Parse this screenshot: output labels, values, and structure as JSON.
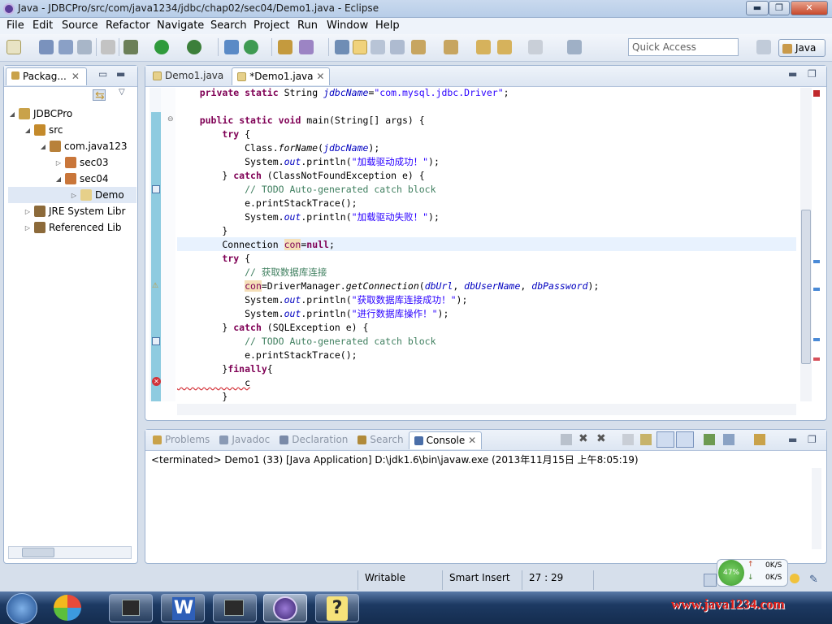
{
  "window": {
    "title": "Java - JDBCPro/src/com/java1234/jdbc/chap02/sec04/Demo1.java - Eclipse",
    "min": "▬",
    "max": "❐",
    "close": "✕"
  },
  "menu": [
    "File",
    "Edit",
    "Source",
    "Refactor",
    "Navigate",
    "Search",
    "Project",
    "Run",
    "Window",
    "Help"
  ],
  "toolbar": {
    "quick_access_placeholder": "Quick Access",
    "perspective": "Java"
  },
  "package_explorer": {
    "tab": "Packag...",
    "tree": [
      {
        "label": "JDBCPro",
        "twisty": "◢",
        "icon_color": "#c9a24a",
        "indent": 0
      },
      {
        "label": "src",
        "twisty": "◢",
        "icon_color": "#c48a2b",
        "indent": 1
      },
      {
        "label": "com.java123",
        "twisty": "◢",
        "icon_color": "#b8813a",
        "indent": 2
      },
      {
        "label": "sec03",
        "twisty": "▷",
        "icon_color": "#c9763a",
        "indent": 3
      },
      {
        "label": "sec04",
        "twisty": "◢",
        "icon_color": "#c9763a",
        "indent": 3
      },
      {
        "label": "Demo",
        "twisty": "▷",
        "icon_color": "#e6d08a",
        "indent": 4,
        "selected": true
      },
      {
        "label": "JRE System Libr",
        "twisty": "▷",
        "icon_color": "#8c6a3a",
        "indent": 1
      },
      {
        "label": "Referenced Lib",
        "twisty": "▷",
        "icon_color": "#8c6a3a",
        "indent": 1
      }
    ]
  },
  "editor": {
    "tabs": [
      {
        "label": "Demo1.java",
        "active": false
      },
      {
        "label": "*Demo1.java",
        "active": true
      }
    ],
    "lines": [
      [
        {
          "t": "    "
        },
        {
          "t": "private",
          "c": "kw"
        },
        {
          "t": " "
        },
        {
          "t": "static",
          "c": "kw"
        },
        {
          "t": " String "
        },
        {
          "t": "jdbcName",
          "c": "fi it"
        },
        {
          "t": "="
        },
        {
          "t": "\"com.mysql.jdbc.Driver\"",
          "c": "st"
        },
        {
          "t": ";"
        }
      ],
      [
        {
          "t": " "
        }
      ],
      [
        {
          "t": "    "
        },
        {
          "t": "public",
          "c": "kw"
        },
        {
          "t": " "
        },
        {
          "t": "static",
          "c": "kw"
        },
        {
          "t": " "
        },
        {
          "t": "void",
          "c": "kw"
        },
        {
          "t": " main(String[] args) {"
        }
      ],
      [
        {
          "t": "        "
        },
        {
          "t": "try",
          "c": "kw"
        },
        {
          "t": " {"
        }
      ],
      [
        {
          "t": "            Class."
        },
        {
          "t": "forName",
          "c": "it"
        },
        {
          "t": "("
        },
        {
          "t": "jdbcName",
          "c": "fi it"
        },
        {
          "t": ");"
        }
      ],
      [
        {
          "t": "            System."
        },
        {
          "t": "out",
          "c": "fi it"
        },
        {
          "t": ".println("
        },
        {
          "t": "\"加载驱动成功！\"",
          "c": "st"
        },
        {
          "t": ");"
        }
      ],
      [
        {
          "t": "        } "
        },
        {
          "t": "catch",
          "c": "kw"
        },
        {
          "t": " (ClassNotFoundException e) {"
        }
      ],
      [
        {
          "t": "            "
        },
        {
          "t": "// TODO Auto-generated catch block",
          "c": "cm"
        }
      ],
      [
        {
          "t": "            e.printStackTrace();"
        }
      ],
      [
        {
          "t": "            System."
        },
        {
          "t": "out",
          "c": "fi it"
        },
        {
          "t": ".println("
        },
        {
          "t": "\"加载驱动失败！\"",
          "c": "st"
        },
        {
          "t": ");"
        }
      ],
      [
        {
          "t": "        }"
        }
      ],
      [
        {
          "t": "        Connection "
        },
        {
          "t": "con",
          "c": "hl"
        },
        {
          "t": "="
        },
        {
          "t": "null",
          "c": "kw"
        },
        {
          "t": ";"
        }
      ],
      [
        {
          "t": "        "
        },
        {
          "t": "try",
          "c": "kw"
        },
        {
          "t": " {"
        }
      ],
      [
        {
          "t": "            "
        },
        {
          "t": "// 获取数据库连接",
          "c": "cm"
        }
      ],
      [
        {
          "t": "            "
        },
        {
          "t": "con",
          "c": "hl"
        },
        {
          "t": "=DriverManager."
        },
        {
          "t": "getConnection",
          "c": "it"
        },
        {
          "t": "("
        },
        {
          "t": "dbUrl",
          "c": "fi it"
        },
        {
          "t": ", "
        },
        {
          "t": "dbUserName",
          "c": "fi it"
        },
        {
          "t": ", "
        },
        {
          "t": "dbPassword",
          "c": "fi it"
        },
        {
          "t": ");"
        }
      ],
      [
        {
          "t": "            System."
        },
        {
          "t": "out",
          "c": "fi it"
        },
        {
          "t": ".println("
        },
        {
          "t": "\"获取数据库连接成功！\"",
          "c": "st"
        },
        {
          "t": ");"
        }
      ],
      [
        {
          "t": "            System."
        },
        {
          "t": "out",
          "c": "fi it"
        },
        {
          "t": ".println("
        },
        {
          "t": "\"进行数据库操作！\"",
          "c": "st"
        },
        {
          "t": ");"
        }
      ],
      [
        {
          "t": "        } "
        },
        {
          "t": "catch",
          "c": "kw"
        },
        {
          "t": " (SQLException e) {"
        }
      ],
      [
        {
          "t": "            "
        },
        {
          "t": "// TODO Auto-generated catch block",
          "c": "cm"
        }
      ],
      [
        {
          "t": "            e.printStackTrace();"
        }
      ],
      [
        {
          "t": "        }"
        },
        {
          "t": "finally",
          "c": "kw"
        },
        {
          "t": "{"
        }
      ],
      [
        {
          "t": "            c"
        }
      ],
      [
        {
          "t": "        }"
        }
      ]
    ]
  },
  "bottom": {
    "tabs": [
      {
        "label": "Problems"
      },
      {
        "label": "Javadoc"
      },
      {
        "label": "Declaration"
      },
      {
        "label": "Search"
      },
      {
        "label": "Console",
        "active": true
      }
    ],
    "console_status": "<terminated> Demo1 (33) [Java Application] D:\\jdk1.6\\bin\\javaw.exe (2013年11月15日 上午8:05:19)"
  },
  "status": {
    "writable": "Writable",
    "insert_mode": "Smart Insert",
    "position": "27 : 29"
  },
  "net_widget": {
    "percent": "47%",
    "up": "0K/S",
    "down": "0K/S"
  },
  "watermark": "www.java1234.com"
}
